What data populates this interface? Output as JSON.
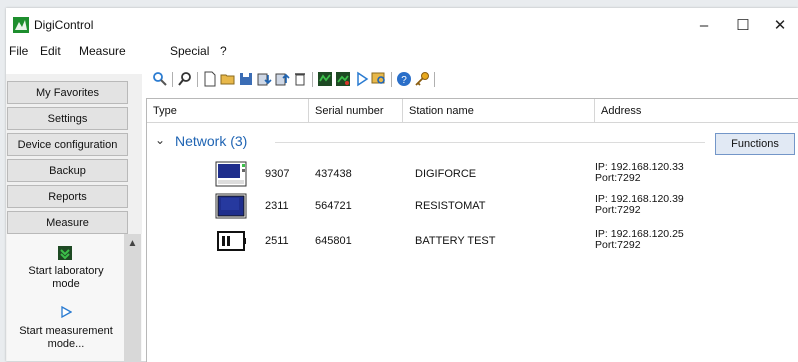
{
  "window": {
    "title": "DigiControl",
    "controls": [
      "–",
      "☐",
      "✕"
    ]
  },
  "menu": [
    "File",
    "Edit",
    "Measure",
    "Special",
    "?"
  ],
  "sidebar": {
    "buttons": [
      "My Favorites",
      "Settings",
      "Device configuration",
      "Backup",
      "Reports",
      "Measure"
    ],
    "panel_items": [
      {
        "label_lines": [
          "Start laboratory",
          "mode"
        ],
        "icon": "lab-mode-icon"
      },
      {
        "label_lines": [
          "Start measurement",
          "mode..."
        ],
        "icon": "play-icon"
      }
    ]
  },
  "toolbar": {
    "icons": [
      "search-icon",
      "find-icon",
      "new-file-icon",
      "open-folder-icon",
      "save-icon",
      "device-download-icon",
      "device-upload-icon",
      "delete-icon",
      "monitor-icon",
      "monitor-record-icon",
      "play-icon",
      "zoom-icon",
      "help-icon",
      "key-icon"
    ]
  },
  "columns": [
    "Type",
    "Serial number",
    "Station name",
    "Address"
  ],
  "group": {
    "label": "Network (3)",
    "functions_label": "Functions"
  },
  "devices": [
    {
      "type": "9307",
      "serial": "437438",
      "station": "DIGIFORCE",
      "ip": "IP: 192.168.120.33",
      "port": "Port:7292",
      "icon": "digiforce-device-icon"
    },
    {
      "type": "2311",
      "serial": "564721",
      "station": "RESISTOMAT",
      "ip": "IP: 192.168.120.39",
      "port": "Port:7292",
      "icon": "resistomat-device-icon"
    },
    {
      "type": "2511",
      "serial": "645801",
      "station": "BATTERY TEST",
      "ip": "IP: 192.168.120.25",
      "port": "Port:7292",
      "icon": "battery-device-icon"
    }
  ],
  "colors": {
    "accent_blue": "#1f64b3",
    "app_green": "#1e8e2e",
    "device_blue": "#1f2e8c"
  }
}
